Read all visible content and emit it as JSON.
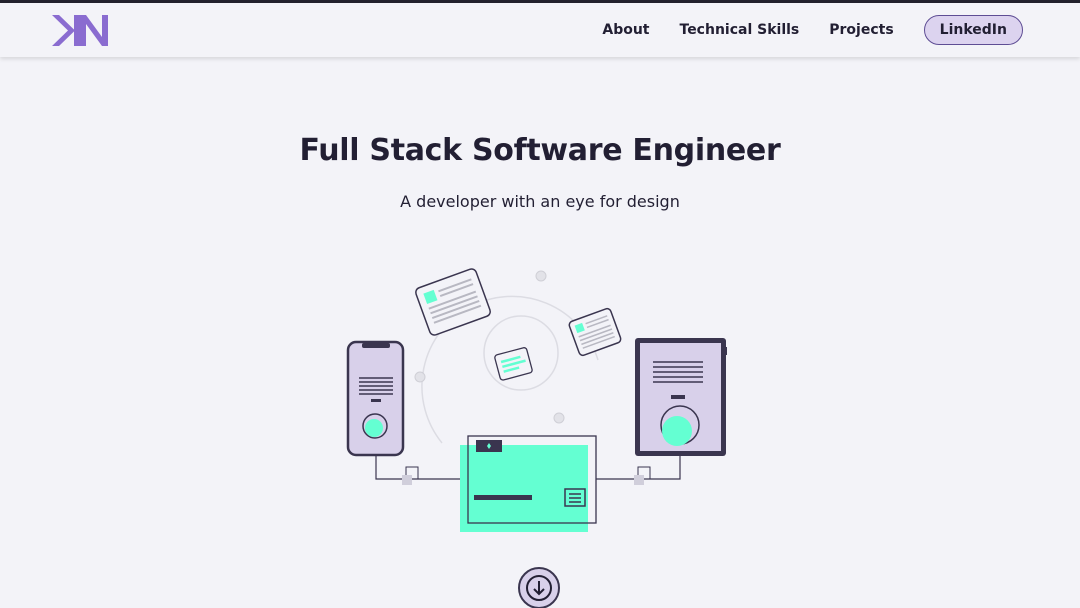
{
  "brand": {
    "logo_icon": "kn-monogram-logo",
    "accent_color": "#8a6cd0"
  },
  "nav": {
    "items": [
      {
        "label": "About"
      },
      {
        "label": "Technical Skills"
      },
      {
        "label": "Projects"
      }
    ],
    "cta_label": "LinkedIn"
  },
  "hero": {
    "title": "Full Stack Software Engineer",
    "subtitle": "A developer with an eye for design",
    "illustration_icon": "devices-sync-illustration",
    "scroll_icon": "arrow-down-circle-icon"
  },
  "colors": {
    "background": "#f3f3f8",
    "text": "#221f33",
    "mint": "#64ffd2",
    "lavender": "#d8d0ea",
    "pill_border": "#5e4d94"
  }
}
